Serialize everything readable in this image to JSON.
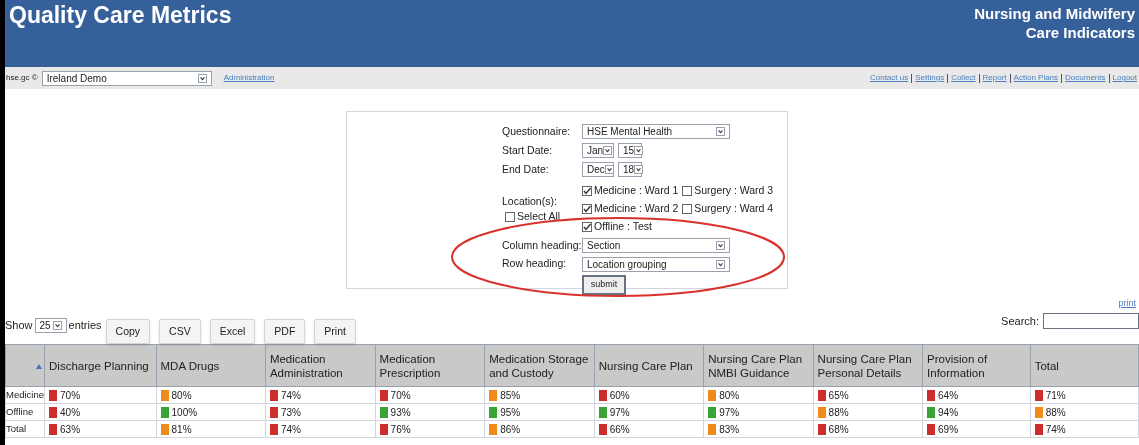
{
  "header": {
    "title": "Quality Care Metrics",
    "subtitle_lines": [
      "Nursing and Midwifery",
      "Care Indicators"
    ]
  },
  "nav": {
    "site_label": "hse.gc ©",
    "site_select": "Ireland Demo",
    "admin_link": "Administration",
    "links": [
      "Contact us",
      "Settings",
      "Collect",
      "Report",
      "Action Plans",
      "Documents",
      "Logout"
    ]
  },
  "form": {
    "questionnaire": {
      "label": "Questionnaire:",
      "value": "HSE Mental Health"
    },
    "start_date": {
      "label": "Start Date:",
      "month": "Jan",
      "day": "15"
    },
    "end_date": {
      "label": "End Date:",
      "month": "Dec",
      "day": "18"
    },
    "locations": {
      "label": "Location(s):",
      "select_all": {
        "label": "Select All",
        "checked": false
      },
      "options": [
        {
          "label": "Medicine : Ward 1",
          "checked": true
        },
        {
          "label": "Surgery : Ward 3",
          "checked": false
        },
        {
          "label": "Medicine : Ward 2",
          "checked": true
        },
        {
          "label": "Surgery : Ward 4",
          "checked": false
        },
        {
          "label": "Offline : Test",
          "checked": true
        }
      ]
    },
    "column_heading": {
      "label": "Column heading:",
      "value": "Section"
    },
    "row_heading": {
      "label": "Row heading:",
      "value": "Location grouping"
    },
    "submit": "submit",
    "highlighted": true
  },
  "table_controls": {
    "show_label": "Show",
    "entries_value": "25",
    "entries_label": "entries",
    "buttons": [
      "Copy",
      "CSV",
      "Excel",
      "PDF",
      "Print"
    ],
    "print_link": "print",
    "search_label": "Search:"
  },
  "table": {
    "columns": [
      "Discharge Planning",
      "MDA Drugs",
      "Medication Administration",
      "Medication Prescription",
      "Medication Storage and Custody",
      "Nursing Care Plan",
      "Nursing Care Plan NMBI Guidance",
      "Nursing Care Plan Personal Details",
      "Provision of Information",
      "Total"
    ],
    "rows": [
      {
        "label": "Medicine",
        "cells": [
          {
            "value": "70%",
            "color": "#cc2e2e"
          },
          {
            "value": "80%",
            "color": "#f08a1c"
          },
          {
            "value": "74%",
            "color": "#cc2e2e"
          },
          {
            "value": "70%",
            "color": "#cc2e2e"
          },
          {
            "value": "85%",
            "color": "#f08a1c"
          },
          {
            "value": "60%",
            "color": "#cc2e2e"
          },
          {
            "value": "80%",
            "color": "#f08a1c"
          },
          {
            "value": "65%",
            "color": "#cc2e2e"
          },
          {
            "value": "64%",
            "color": "#cc2e2e"
          },
          {
            "value": "71%",
            "color": "#cc2e2e"
          }
        ]
      },
      {
        "label": "Offline",
        "cells": [
          {
            "value": "40%",
            "color": "#cc2e2e"
          },
          {
            "value": "100%",
            "color": "#3aa336"
          },
          {
            "value": "73%",
            "color": "#cc2e2e"
          },
          {
            "value": "93%",
            "color": "#3aa336"
          },
          {
            "value": "95%",
            "color": "#3aa336"
          },
          {
            "value": "97%",
            "color": "#3aa336"
          },
          {
            "value": "97%",
            "color": "#3aa336"
          },
          {
            "value": "88%",
            "color": "#f08a1c"
          },
          {
            "value": "94%",
            "color": "#3aa336"
          },
          {
            "value": "88%",
            "color": "#f08a1c"
          }
        ]
      },
      {
        "label": "Total",
        "cells": [
          {
            "value": "63%",
            "color": "#cc2e2e"
          },
          {
            "value": "81%",
            "color": "#f08a1c"
          },
          {
            "value": "74%",
            "color": "#cc2e2e"
          },
          {
            "value": "76%",
            "color": "#cc2e2e"
          },
          {
            "value": "86%",
            "color": "#f08a1c"
          },
          {
            "value": "66%",
            "color": "#cc2e2e"
          },
          {
            "value": "83%",
            "color": "#f08a1c"
          },
          {
            "value": "68%",
            "color": "#cc2e2e"
          },
          {
            "value": "69%",
            "color": "#cc2e2e"
          },
          {
            "value": "74%",
            "color": "#cc2e2e"
          }
        ]
      }
    ]
  }
}
